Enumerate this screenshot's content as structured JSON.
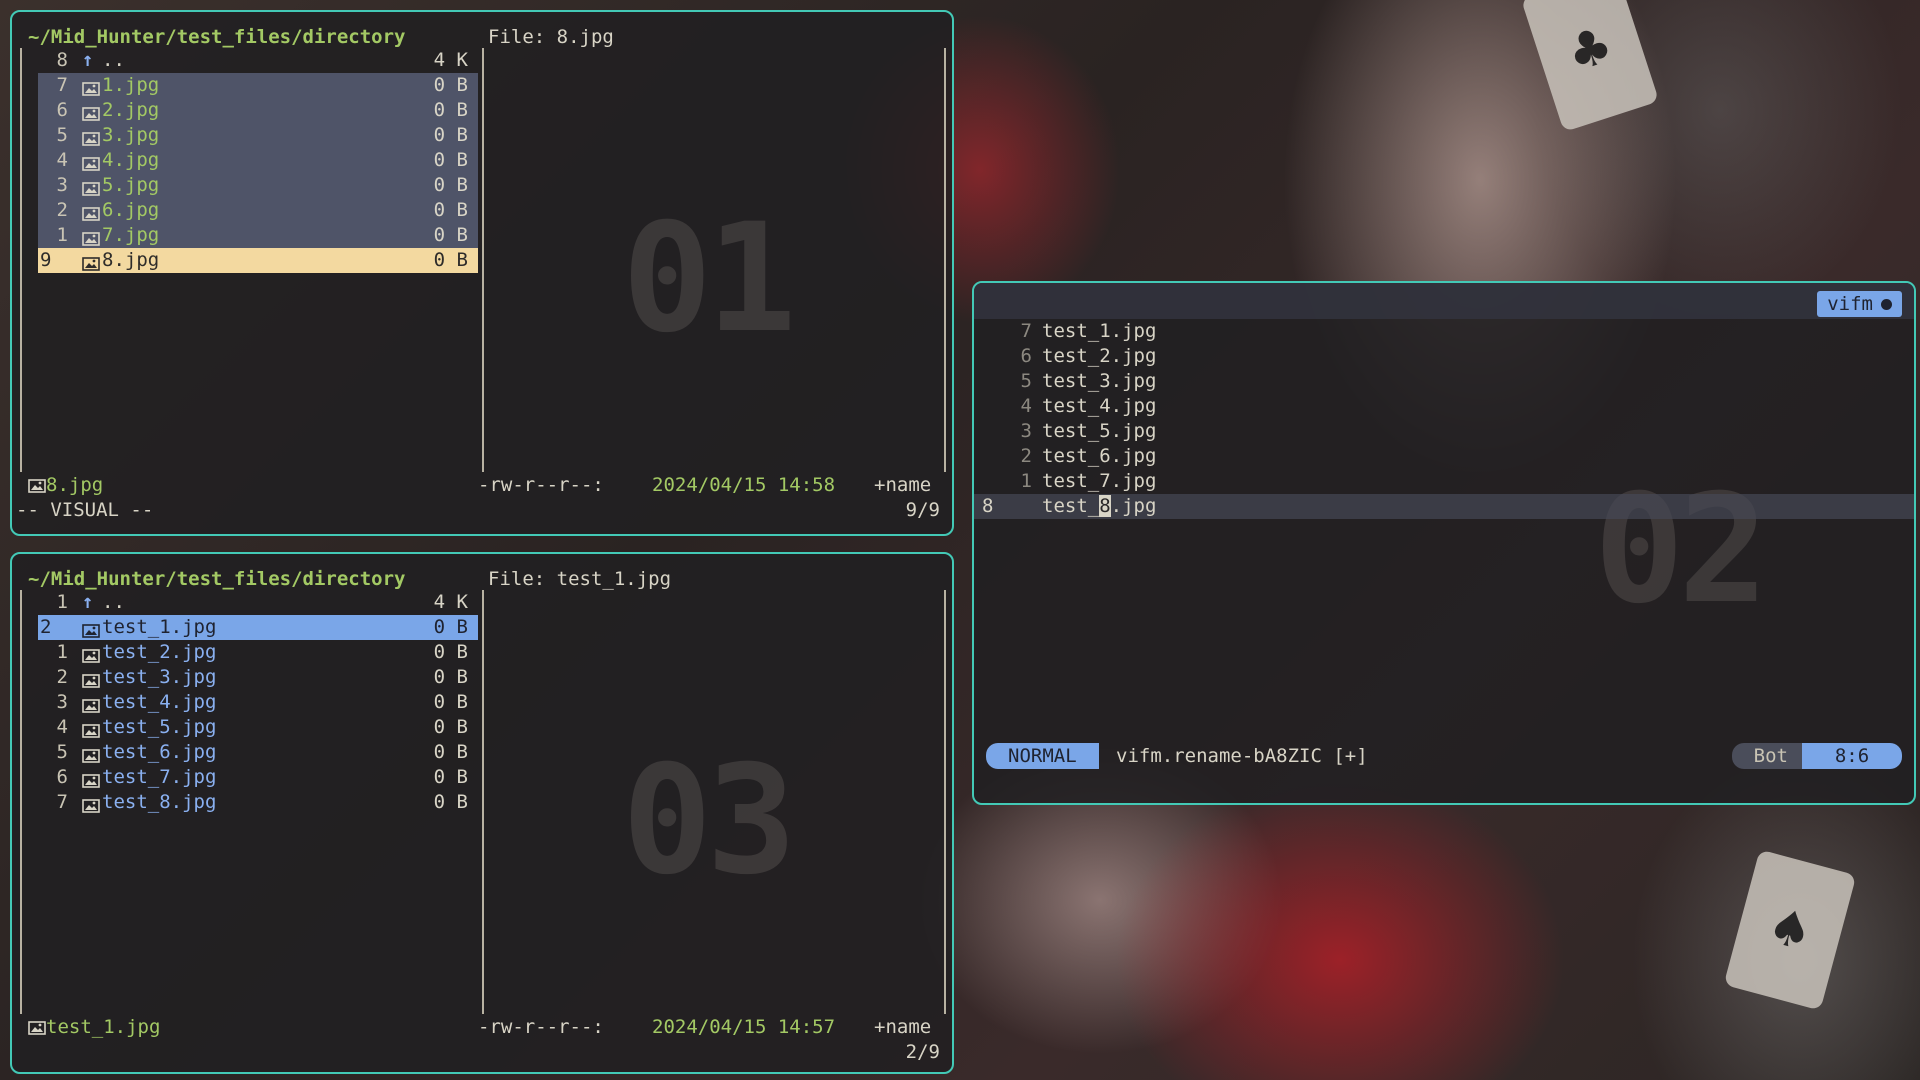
{
  "top_pane": {
    "path": "~/Mid_Hunter/test_files/directory",
    "file_header": "File: 8.jpg",
    "rows": [
      {
        "num": "8",
        "name": "..",
        "size": "4 K",
        "kind": "parent"
      },
      {
        "num": "7",
        "name": "1.jpg",
        "size": "0 B",
        "kind": "selected"
      },
      {
        "num": "6",
        "name": "2.jpg",
        "size": "0 B",
        "kind": "selected"
      },
      {
        "num": "5",
        "name": "3.jpg",
        "size": "0 B",
        "kind": "selected"
      },
      {
        "num": "4",
        "name": "4.jpg",
        "size": "0 B",
        "kind": "selected"
      },
      {
        "num": "3",
        "name": "5.jpg",
        "size": "0 B",
        "kind": "selected"
      },
      {
        "num": "2",
        "name": "6.jpg",
        "size": "0 B",
        "kind": "selected"
      },
      {
        "num": "1",
        "name": "7.jpg",
        "size": "0 B",
        "kind": "selected"
      },
      {
        "num": "9",
        "name": "8.jpg",
        "size": "0 B",
        "kind": "cursor"
      }
    ],
    "status_file": "8.jpg",
    "permissions": "-rw-r--r--:",
    "date": "2024/04/15 14:58",
    "sort": "+name",
    "count": "9/9",
    "mode": "-- VISUAL --",
    "watermark": "01"
  },
  "bottom_pane": {
    "path": "~/Mid_Hunter/test_files/directory",
    "file_header": "File: test_1.jpg",
    "rows": [
      {
        "num": "1",
        "name": "..",
        "size": "4 K",
        "kind": "parent"
      },
      {
        "num": "2",
        "name": "test_1.jpg",
        "size": "0 B",
        "kind": "cursor"
      },
      {
        "num": "1",
        "name": "test_2.jpg",
        "size": "0 B",
        "kind": "normal"
      },
      {
        "num": "2",
        "name": "test_3.jpg",
        "size": "0 B",
        "kind": "normal"
      },
      {
        "num": "3",
        "name": "test_4.jpg",
        "size": "0 B",
        "kind": "normal"
      },
      {
        "num": "4",
        "name": "test_5.jpg",
        "size": "0 B",
        "kind": "normal"
      },
      {
        "num": "5",
        "name": "test_6.jpg",
        "size": "0 B",
        "kind": "normal"
      },
      {
        "num": "6",
        "name": "test_7.jpg",
        "size": "0 B",
        "kind": "normal"
      },
      {
        "num": "7",
        "name": "test_8.jpg",
        "size": "0 B",
        "kind": "normal"
      }
    ],
    "status_file": "test_1.jpg",
    "permissions": "-rw-r--r--:",
    "date": "2024/04/15 14:57",
    "sort": "+name",
    "count": "2/9",
    "watermark": "03"
  },
  "editor": {
    "tab_label": "vifm",
    "lines": [
      {
        "ln": "7",
        "text": "test_1.jpg"
      },
      {
        "ln": "6",
        "text": "test_2.jpg"
      },
      {
        "ln": "5",
        "text": "test_3.jpg"
      },
      {
        "ln": "4",
        "text": "test_4.jpg"
      },
      {
        "ln": "3",
        "text": "test_5.jpg"
      },
      {
        "ln": "2",
        "text": "test_6.jpg"
      },
      {
        "ln": "1",
        "text": "test_7.jpg"
      }
    ],
    "current_line": {
      "ln": "8",
      "before": "test_",
      "cursor_char": "8",
      "after": ".jpg"
    },
    "statusline": {
      "mode": "NORMAL",
      "filename": "vifm.rename-bA8ZIC [+]",
      "scroll": "Bot",
      "position": "8:6"
    },
    "watermark": "02"
  },
  "colors": {
    "border": "#43c9b6",
    "accent_green": "#a3c964",
    "accent_blue": "#7aa6e8",
    "cursor_yellow": "#f3d9a0"
  },
  "icons": {
    "file": "image-file-icon",
    "parent": "up-arrow-icon"
  }
}
